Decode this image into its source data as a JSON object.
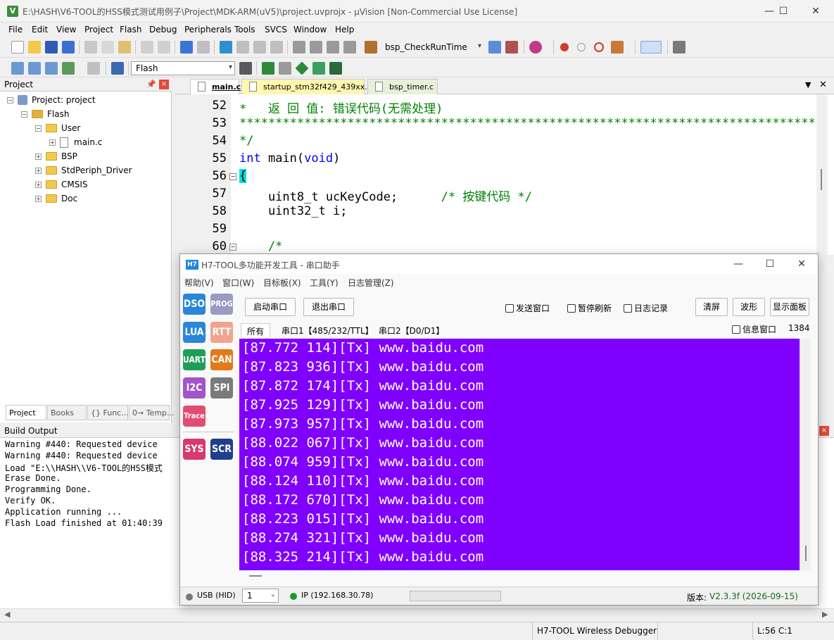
{
  "titlebar": {
    "title": "E:\\HASH\\V6-TOOL的HSS模式测试用例子\\Project\\MDK-ARM(uV5)\\project.uvprojx - µVision  [Non-Commercial Use License]",
    "app_icon_text": "V",
    "minimize": "—",
    "maximize": "☐",
    "close": "✕"
  },
  "menu": [
    "File",
    "Edit",
    "View",
    "Project",
    "Flash",
    "Debug",
    "Peripherals",
    "Tools",
    "SVCS",
    "Window",
    "Help"
  ],
  "toolbar1": {
    "function_combo": "bsp_CheckRunTime"
  },
  "toolbar2": {
    "target_combo": "Flash"
  },
  "project_panel": {
    "title": "Project",
    "tree": [
      {
        "label": "Project: project",
        "level": 0,
        "type": "project"
      },
      {
        "label": "Flash",
        "level": 1,
        "type": "target"
      },
      {
        "label": "User",
        "level": 2,
        "type": "folder"
      },
      {
        "label": "main.c",
        "level": 3,
        "type": "file"
      },
      {
        "label": "BSP",
        "level": 2,
        "type": "folder"
      },
      {
        "label": "StdPeriph_Driver",
        "level": 2,
        "type": "folder"
      },
      {
        "label": "CMSIS",
        "level": 2,
        "type": "folder"
      },
      {
        "label": "Doc",
        "level": 2,
        "type": "folder"
      }
    ],
    "tabs": [
      "Project",
      "Books",
      "{} Func...",
      "0→ Temp..."
    ]
  },
  "editor": {
    "tabs": [
      "main.c",
      "startup_stm32f429_439xx.s",
      "bsp_timer.c"
    ],
    "lines": [
      {
        "num": "52",
        "text": "*   返 回 值: 错误代码(无需处理)",
        "type": "comment"
      },
      {
        "num": "53",
        "text": "*******************************************************************************************************",
        "type": "comment"
      },
      {
        "num": "54",
        "text": "*/",
        "type": "comment"
      },
      {
        "num": "55",
        "text": "int main(void)",
        "type": "code"
      },
      {
        "num": "56",
        "text": "{",
        "type": "code"
      },
      {
        "num": "57",
        "text": "    uint8_t ucKeyCode;      /* 按键代码 */",
        "type": "code"
      },
      {
        "num": "58",
        "text": "    uint32_t i;",
        "type": "code"
      },
      {
        "num": "59",
        "text": "",
        "type": "code"
      },
      {
        "num": "60",
        "text": "    /*",
        "type": "comment"
      }
    ]
  },
  "build_output": {
    "title": "Build Output",
    "lines": [
      "Warning #440: Requested device",
      "Warning #440: Requested device",
      "Load \"E:\\\\HASH\\\\V6-TOOL的HSS模式",
      "Erase Done.",
      "Programming Done.",
      "Verify OK.",
      "Application running ...",
      "Flash Load finished at 01:40:39"
    ]
  },
  "statusbar": {
    "debugger": "H7-TOOL Wireless Debugger",
    "position": "L:56 C:1"
  },
  "h7tool": {
    "title": "H7-TOOL多功能开发工具 - 串口助手",
    "logo": "H7",
    "menu": [
      "帮助(V)",
      "窗口(W)",
      "目标板(X)",
      "工具(Y)",
      "日志管理(Z)"
    ],
    "side_buttons": [
      {
        "label": "DSO",
        "color": "#2a86d8"
      },
      {
        "label": "PROG",
        "color": "#9b9bc5"
      },
      {
        "label": "LUA",
        "color": "#2a86d8"
      },
      {
        "label": "RTT",
        "color": "#f2a38f"
      },
      {
        "label": "UART",
        "color": "#1f9e5a"
      },
      {
        "label": "CAN",
        "color": "#e27a1a"
      },
      {
        "label": "I2C",
        "color": "#a055c8"
      },
      {
        "label": "SPI",
        "color": "#7a7a7a"
      },
      {
        "label": "Trace",
        "color": "#e34b73"
      },
      {
        "label": "SYS",
        "color": "#d9386e"
      },
      {
        "label": "SCR",
        "color": "#1f3f8c"
      }
    ],
    "buttons": {
      "start": "启动串口",
      "exit": "退出串口",
      "clear": "清屏",
      "wave": "波形",
      "panel": "显示面板"
    },
    "checkboxes": {
      "send_window": "发送窗口",
      "pause_refresh": "暂停刷新",
      "log_record": "日志记录",
      "info_window": "信息窗口"
    },
    "tabs": [
      "所有",
      "串口1【485/232/TTL】",
      "串口2【D0/D1】"
    ],
    "count": "1384",
    "terminal_lines": [
      "[87.772 114][Tx] www.baidu.com",
      "[87.823 936][Tx] www.baidu.com",
      "[87.872 174][Tx] www.baidu.com",
      "[87.925 129][Tx] www.baidu.com",
      "[87.973 957][Tx] www.baidu.com",
      "[88.022 067][Tx] www.baidu.com",
      "[88.074 959][Tx] www.baidu.com",
      "[88.124 110][Tx] www.baidu.com",
      "[88.172 670][Tx] www.baidu.com",
      "[88.223 015][Tx] www.baidu.com",
      "[88.274 321][Tx] www.baidu.com",
      "[88.325 214][Tx] www.baidu.com"
    ],
    "status": {
      "usb": "USB (HID)",
      "port_value": "1",
      "ip": "IP (192.168.30.78)",
      "version_label": "版本:",
      "version": "V2.3.3f (2026-09-15)"
    }
  }
}
